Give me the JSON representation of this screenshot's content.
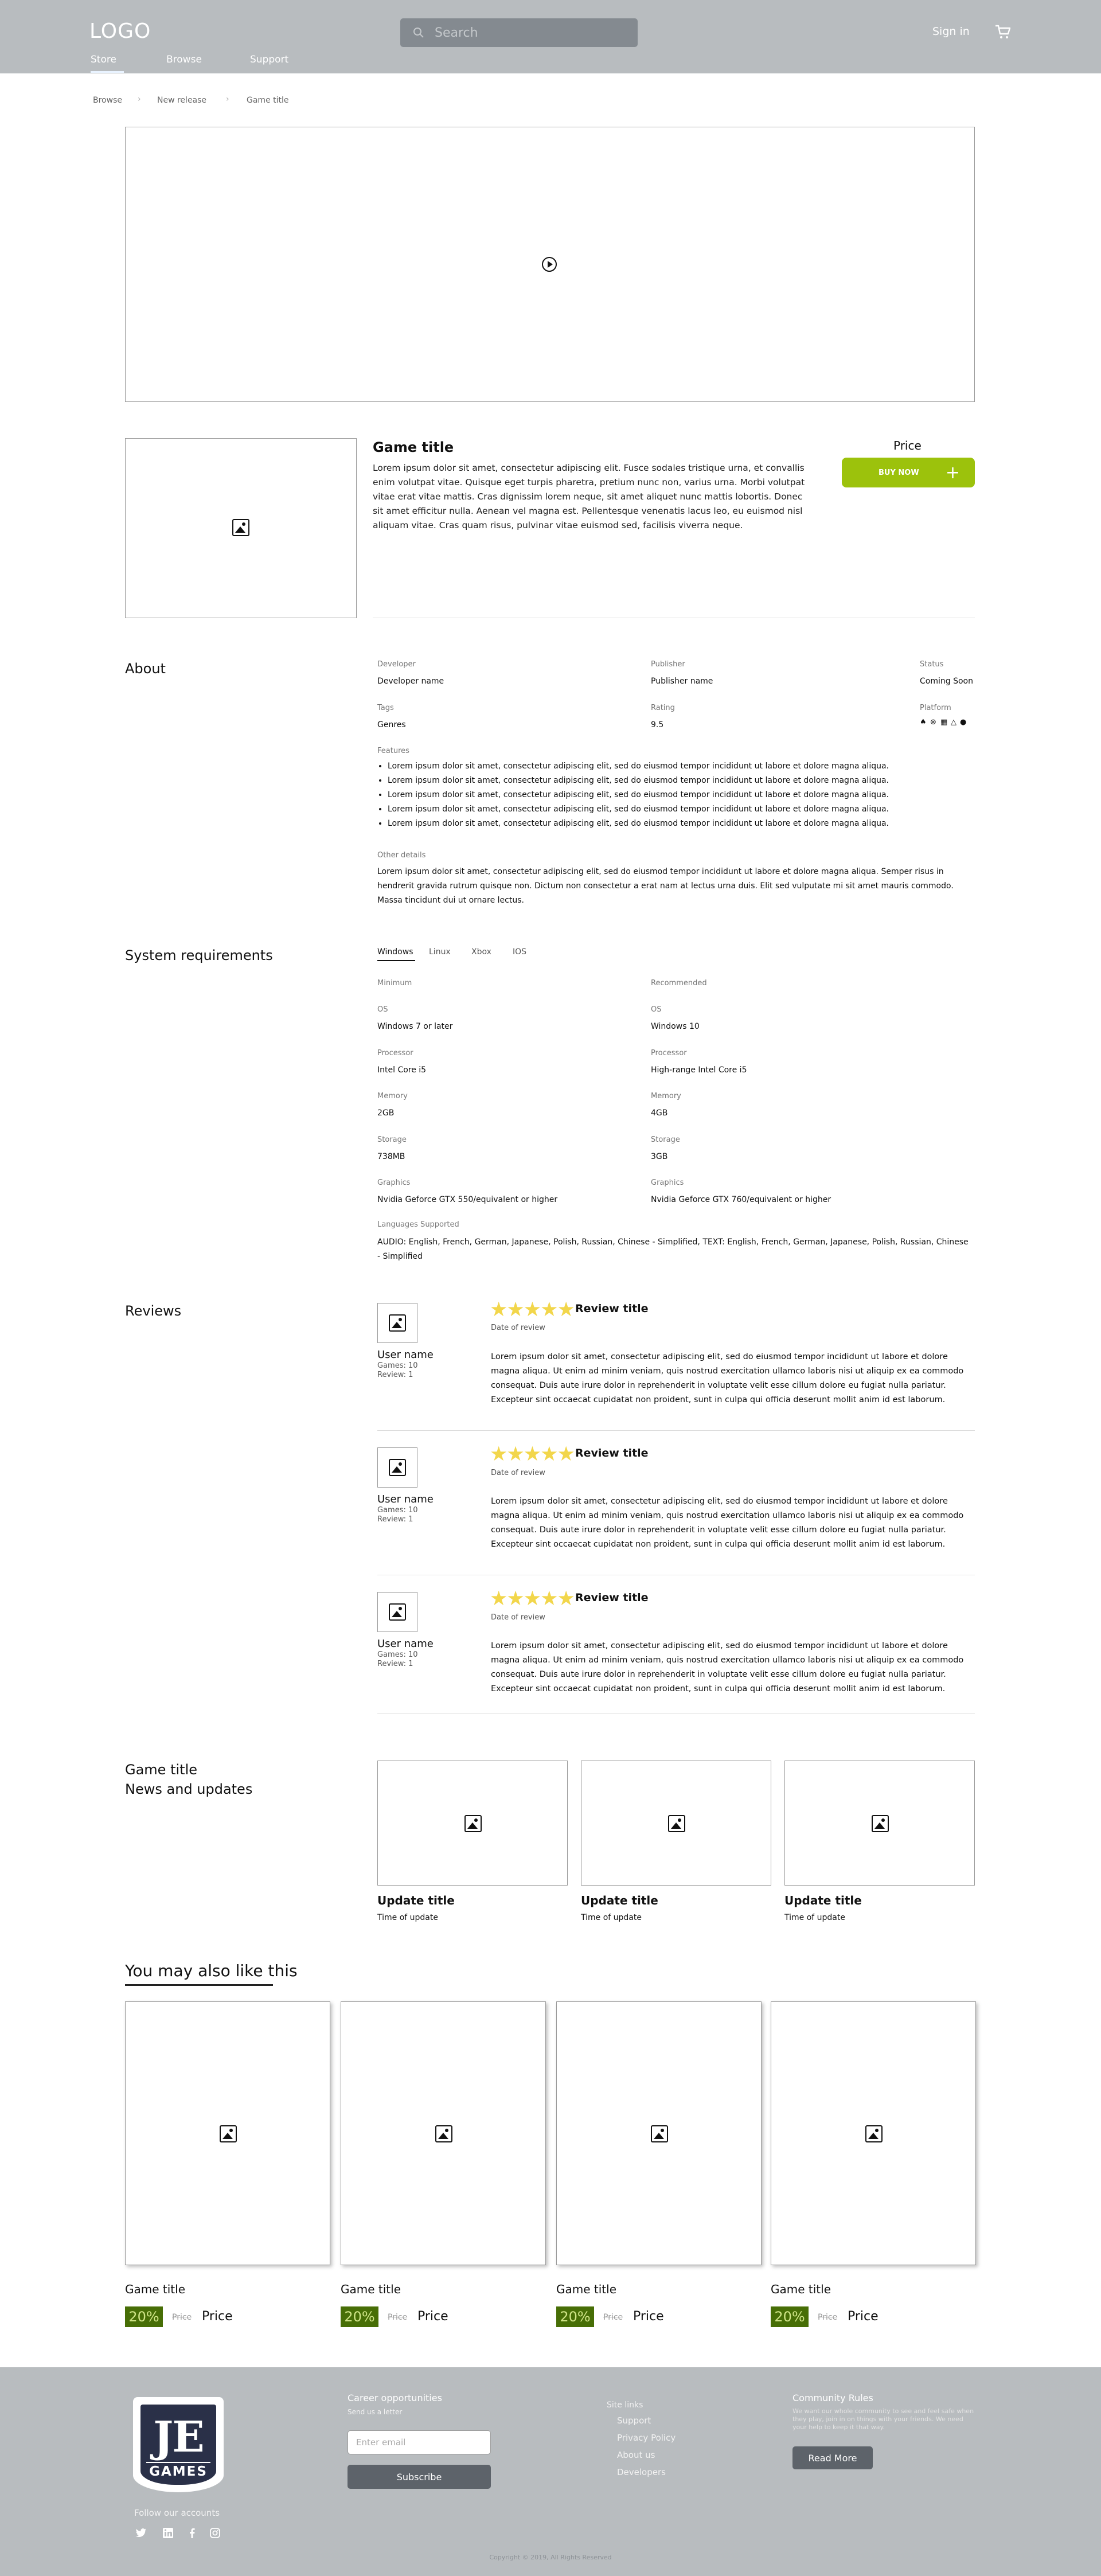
{
  "header": {
    "logo": "LOGO",
    "search_placeholder": "Search",
    "sign_in": "Sign in",
    "nav": [
      "Store",
      "Browse",
      "Support"
    ]
  },
  "breadcrumb": [
    "Browse",
    "New release",
    "Game title"
  ],
  "game": {
    "title": "Game title",
    "description": "Lorem ipsum dolor sit amet, consectetur adipiscing elit. Fusce sodales tristique urna, et convallis enim volutpat vitae. Quisque eget turpis pharetra, pretium nunc non, varius urna. Morbi volutpat vitae erat vitae mattis. Cras dignissim lorem neque, sit amet aliquet nunc mattis lobortis. Donec sit amet efficitur nulla. Aenean vel magna est. Pellentesque venenatis lacus leo, eu euismod nisl aliquam vitae. Cras quam risus, pulvinar vitae euismod sed, facilisis viverra neque.",
    "price_label": "Price",
    "buy_label": "BUY NOW"
  },
  "about": {
    "heading": "About",
    "developer_label": "Developer",
    "developer": "Developer name",
    "publisher_label": "Publisher",
    "publisher": "Publisher name",
    "status_label": "Status",
    "status": "Coming Soon",
    "tags_label": "Tags",
    "tags": "Genres",
    "rating_label": "Rating",
    "rating": "9.5",
    "platform_label": "Platform",
    "platform_icons": [
      "playstation-icon",
      "xbox-icon",
      "windows-icon",
      "linux-icon",
      "apple-icon"
    ],
    "features_label": "Features",
    "features": [
      "Lorem ipsum dolor sit amet, consectetur adipiscing elit, sed do eiusmod tempor incididunt ut labore et dolore magna aliqua.",
      "Lorem ipsum dolor sit amet, consectetur adipiscing elit, sed do eiusmod tempor incididunt ut labore et dolore magna aliqua.",
      "Lorem ipsum dolor sit amet, consectetur adipiscing elit, sed do eiusmod tempor incididunt ut labore et dolore magna aliqua.",
      "Lorem ipsum dolor sit amet, consectetur adipiscing elit, sed do eiusmod tempor incididunt ut labore et dolore magna aliqua.",
      "Lorem ipsum dolor sit amet, consectetur adipiscing elit, sed do eiusmod tempor incididunt ut labore et dolore magna aliqua."
    ],
    "other_label": "Other details",
    "other": "Lorem ipsum dolor sit amet, consectetur adipiscing elit, sed do eiusmod tempor incididunt ut labore et dolore magna aliqua. Semper risus in hendrerit gravida rutrum quisque non. Dictum non consectetur a erat nam at lectus urna duis. Elit sed vulputate mi sit amet mauris commodo. Massa tincidunt dui ut ornare lectus."
  },
  "sysreq": {
    "heading": "System requirements",
    "tabs": [
      "Windows",
      "Linux",
      "Xbox",
      "IOS"
    ],
    "min_label": "Minimum",
    "rec_label": "Recommended",
    "rows": [
      {
        "label": "OS",
        "min": "Windows 7 or later",
        "rec": "Windows 10"
      },
      {
        "label": "Processor",
        "min": "Intel Core i5",
        "rec": "High-range Intel Core i5"
      },
      {
        "label": "Memory",
        "min": "2GB",
        "rec": "4GB"
      },
      {
        "label": "Storage",
        "min": "738MB",
        "rec": "3GB"
      },
      {
        "label": "Graphics",
        "min": "Nvidia Geforce GTX 550/equivalent or higher",
        "rec": "Nvidia Geforce GTX 760/equivalent or higher"
      }
    ],
    "lang_label": "Languages Supported",
    "languages": "AUDIO: English, French, German, Japanese, Polish, Russian, Chinese - Simplified, TEXT: English, French, German, Japanese, Polish, Russian, Chinese - Simplified"
  },
  "reviews": {
    "heading": "Reviews",
    "items": [
      {
        "user": "User name",
        "games": "Games: 10",
        "review": "Review: 1",
        "title": "Review title",
        "date": "Date of review",
        "rating": 5,
        "text": "Lorem ipsum dolor sit amet, consectetur adipiscing elit, sed do eiusmod tempor incididunt ut labore et dolore magna aliqua. Ut enim ad minim veniam, quis nostrud exercitation ullamco laboris nisi ut aliquip ex ea commodo consequat. Duis aute irure dolor in reprehenderit in voluptate velit esse cillum dolore eu fugiat nulla pariatur. Excepteur sint occaecat cupidatat non proident, sunt in culpa qui officia deserunt mollit anim id est laborum."
      },
      {
        "user": "User name",
        "games": "Games: 10",
        "review": "Review: 1",
        "title": "Review title",
        "date": "Date of review",
        "rating": 5,
        "text": "Lorem ipsum dolor sit amet, consectetur adipiscing elit, sed do eiusmod tempor incididunt ut labore et dolore magna aliqua. Ut enim ad minim veniam, quis nostrud exercitation ullamco laboris nisi ut aliquip ex ea commodo consequat. Duis aute irure dolor in reprehenderit in voluptate velit esse cillum dolore eu fugiat nulla pariatur. Excepteur sint occaecat cupidatat non proident, sunt in culpa qui officia deserunt mollit anim id est laborum."
      },
      {
        "user": "User name",
        "games": "Games: 10",
        "review": "Review: 1",
        "title": "Review title",
        "date": "Date of review",
        "rating": 5,
        "text": "Lorem ipsum dolor sit amet, consectetur adipiscing elit, sed do eiusmod tempor incididunt ut labore et dolore magna aliqua. Ut enim ad minim veniam, quis nostrud exercitation ullamco laboris nisi ut aliquip ex ea commodo consequat. Duis aute irure dolor in reprehenderit in voluptate velit esse cillum dolore eu fugiat nulla pariatur. Excepteur sint occaecat cupidatat non proident, sunt in culpa qui officia deserunt mollit anim id est laborum."
      }
    ]
  },
  "news": {
    "heading1": "Game title",
    "heading2": "News and updates",
    "items": [
      {
        "title": "Update title",
        "time": "Time of update"
      },
      {
        "title": "Update title",
        "time": "Time of update"
      },
      {
        "title": "Update title",
        "time": "Time of update"
      }
    ]
  },
  "also_like": {
    "heading": "You may also like this",
    "items": [
      {
        "title": "Game title",
        "discount": "20%",
        "old_price": "Price",
        "price": "Price"
      },
      {
        "title": "Game title",
        "discount": "20%",
        "old_price": "Price",
        "price": "Price"
      },
      {
        "title": "Game title",
        "discount": "20%",
        "old_price": "Price",
        "price": "Price"
      },
      {
        "title": "Game title",
        "discount": "20%",
        "old_price": "Price",
        "price": "Price"
      }
    ]
  },
  "footer": {
    "logo_top": "JE",
    "logo_bottom": "GAMES",
    "follow": "Follow our accounts",
    "career_title": "Career opportunities",
    "career_sub": "Send us a letter",
    "email_placeholder": "Enter email",
    "subscribe": "Subscribe",
    "links_title": "Site links",
    "links": [
      "Support",
      "Privacy Policy",
      "About us",
      "Developers"
    ],
    "community_title": "Community Rules",
    "community_text": "We want our whole community to see and feel safe when they play, join in on things with your friends. We need your help to keep it that way.",
    "read_more": "Read More",
    "copyright": "Copyright © 2019, All Rights Reserved",
    "social_icons": [
      "twitter-icon",
      "linkedin-icon",
      "facebook-icon",
      "instagram-icon"
    ]
  },
  "colors": {
    "accent": "#9cc20c",
    "discount_bg": "#476e06",
    "header_bg": "#b8bcbf",
    "star": "#f2d64b"
  }
}
